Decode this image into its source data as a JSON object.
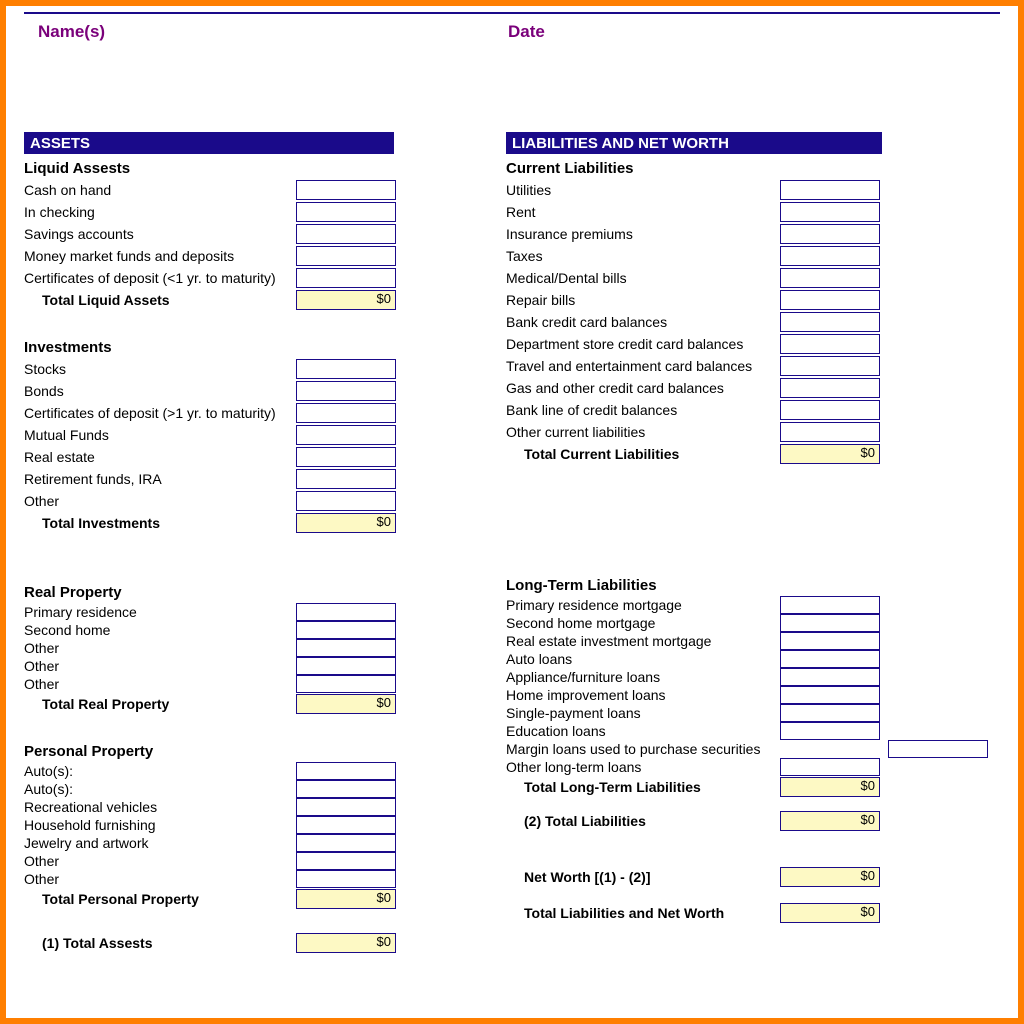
{
  "header": {
    "names": "Name(s)",
    "date": "Date"
  },
  "zero": "$0",
  "left": {
    "barAssets": "ASSETS",
    "liquid": {
      "title": "Liquid Assests",
      "items": [
        "Cash on hand",
        "In checking",
        "Savings accounts",
        "Money market funds and deposits",
        "Certificates of deposit (<1 yr. to maturity)"
      ],
      "totalLabel": "Total Liquid Assets"
    },
    "invest": {
      "title": "Investments",
      "items": [
        "Stocks",
        "Bonds",
        "Certificates of deposit (>1 yr. to maturity)",
        "Mutual Funds",
        "Real estate",
        "Retirement funds, IRA",
        "Other"
      ],
      "totalLabel": "Total Investments"
    },
    "real": {
      "title": "Real Property",
      "items": [
        "Primary residence",
        "Second home",
        "Other",
        "Other",
        "Other"
      ],
      "totalLabel": "Total Real Property"
    },
    "personal": {
      "title": "Personal Property",
      "items": [
        "Auto(s):",
        "Auto(s):",
        "Recreational vehicles",
        "Household furnishing",
        "Jewelry and artwork",
        "Other",
        "Other"
      ],
      "totalLabel": "Total Personal Property"
    },
    "grandTotal": "(1) Total Assests"
  },
  "right": {
    "barLiab": "LIABILITIES AND NET WORTH",
    "current": {
      "title": "Current Liabilities",
      "items": [
        "Utilities",
        "Rent",
        "Insurance premiums",
        "Taxes",
        "Medical/Dental bills",
        "Repair bills",
        "Bank credit card balances",
        "Department store credit card balances",
        "Travel and entertainment card balances",
        "Gas and other credit card balances",
        "Bank line of credit balances",
        "Other current liabilities"
      ],
      "totalLabel": "Total Current Liabilities"
    },
    "long": {
      "title": "Long-Term Liabilities",
      "items": [
        "Primary residence mortgage",
        "Second home mortgage",
        "Real estate investment mortgage",
        "Auto loans",
        "Appliance/furniture loans",
        "Home improvement loans",
        "Single-payment loans",
        "Education loans",
        "Margin loans used to purchase securities",
        "Other long-term loans"
      ],
      "totalLabel": "Total Long-Term Liabilities"
    },
    "totalLiab": "(2) Total Liabilities",
    "netWorth": "Net Worth [(1) - (2)]",
    "totalLiabNet": "Total Liabilities and Net Worth"
  }
}
